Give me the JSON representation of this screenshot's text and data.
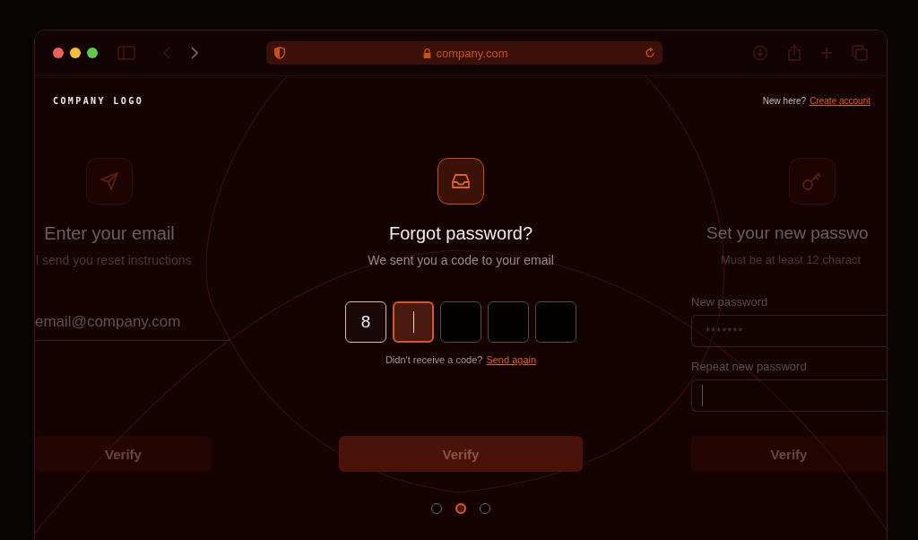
{
  "browser": {
    "url": "company.com"
  },
  "header": {
    "logo": "COMPANY LOGO",
    "prompt": "New here?",
    "link": "Create account"
  },
  "steps": [
    {
      "kind": "email",
      "selected": false,
      "title": "Enter your email",
      "subtitle": "l send you reset instructions",
      "field": {
        "placeholder": "email@company.com"
      },
      "button": {
        "label": "Verify",
        "disabled": true
      }
    },
    {
      "kind": "code",
      "selected": true,
      "title": "Forgot password?",
      "subtitle": "We sent you a code to your email",
      "digits": [
        {
          "value": "8",
          "focused": false
        },
        {
          "focused": true
        },
        {
          "focused": false
        },
        {
          "focused": false
        },
        {
          "focused": false
        }
      ],
      "resend": {
        "prompt": "Didn't receive a code?",
        "link": "Send again"
      },
      "button": {
        "label": "Verify",
        "disabled": true
      }
    },
    {
      "kind": "password",
      "selected": false,
      "title": "Set your new passwo",
      "subtitle": "Must be at least 12 charact",
      "fields": [
        {
          "label": "New password",
          "value": "*******",
          "focused": false
        },
        {
          "label": "Repeat new password",
          "focused": true
        }
      ],
      "button": {
        "label": "Verify",
        "disabled": true
      }
    }
  ],
  "pagination": [
    {
      "selected": false
    },
    {
      "selected": true
    },
    {
      "selected": false
    }
  ]
}
